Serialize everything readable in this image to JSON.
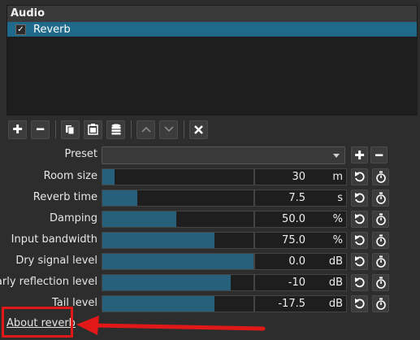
{
  "filter_panel": {
    "header": "Audio",
    "filters": [
      {
        "name": "Reverb",
        "checked": true
      }
    ]
  },
  "toolbar": {
    "buttons": [
      "add-icon",
      "remove-icon",
      "copy-icon",
      "paste-icon",
      "save-icon",
      "move-up-icon",
      "move-down-icon",
      "deselect-icon"
    ]
  },
  "preset": {
    "label": "Preset",
    "value": ""
  },
  "params": [
    {
      "label": "Room size",
      "value": "30",
      "unit": "m",
      "fill": 0.08
    },
    {
      "label": "Reverb time",
      "value": "7.5",
      "unit": "s",
      "fill": 0.23
    },
    {
      "label": "Damping",
      "value": "50.0",
      "unit": "%",
      "fill": 0.49
    },
    {
      "label": "Input bandwidth",
      "value": "75.0",
      "unit": "%",
      "fill": 0.74
    },
    {
      "label": "Dry signal level",
      "value": "0.0",
      "unit": "dB",
      "fill": 1.0
    },
    {
      "label": "Early reflection level",
      "value": "-10",
      "unit": "dB",
      "fill": 0.85
    },
    {
      "label": "Tail level",
      "value": "-17.5",
      "unit": "dB",
      "fill": 0.74
    }
  ],
  "about_link": "About reverb",
  "colors": {
    "accent": "#1f6a8a",
    "annotation": "#e01818"
  }
}
